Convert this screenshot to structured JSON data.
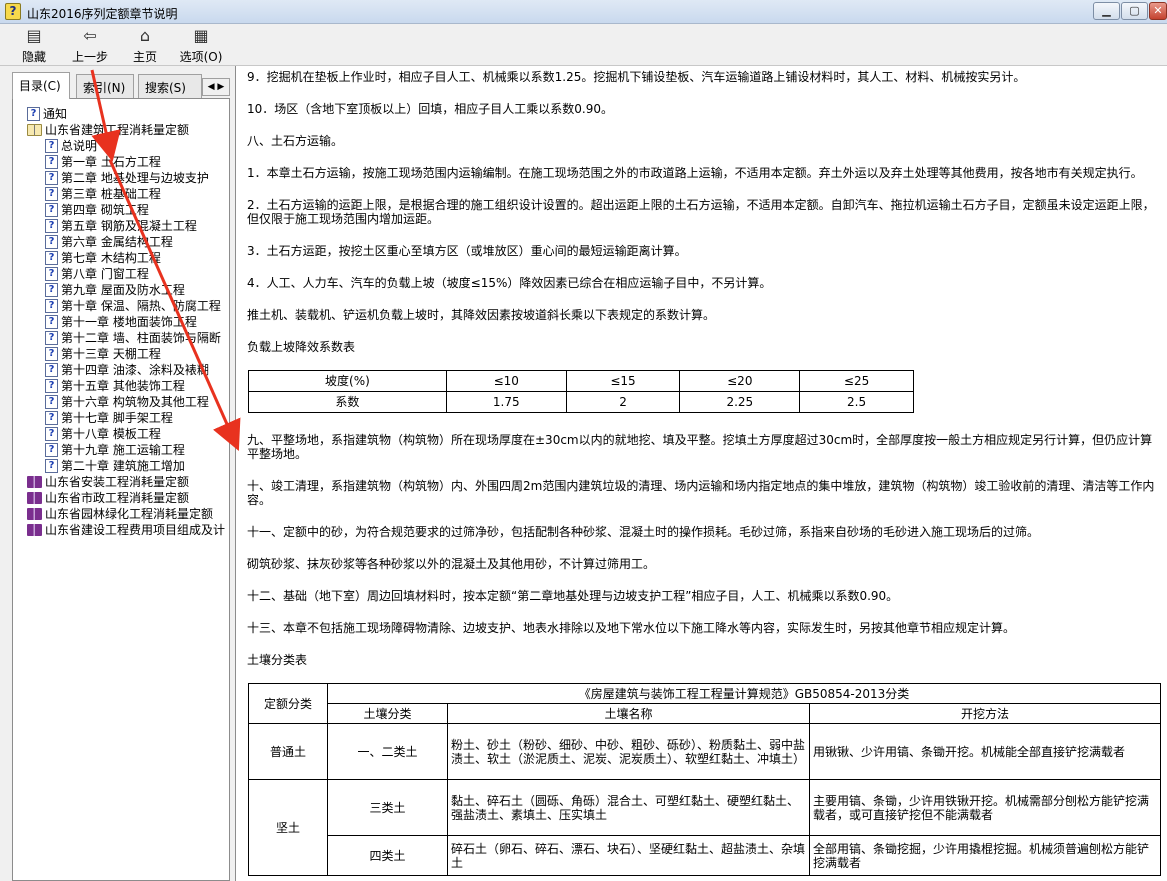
{
  "window": {
    "title": "山东2016序列定额章节说明"
  },
  "toolbar": {
    "hide": "隐藏",
    "back": "上一步",
    "home": "主页",
    "options": "选项(O)"
  },
  "tabs": {
    "contents": "目录(C)",
    "index": "索引(N)",
    "search": "搜索(S)",
    "arrows": "◀ ▶"
  },
  "tree": [
    {
      "label": "通知",
      "icon": "help-page-icon",
      "level": 0
    },
    {
      "label": "山东省建筑工程消耗量定额",
      "icon": "open-book-icon",
      "level": 0
    },
    {
      "label": "总说明",
      "icon": "help-page-icon",
      "level": 1
    },
    {
      "label": "第一章 土石方工程",
      "icon": "help-page-icon",
      "level": 1
    },
    {
      "label": "第二章 地基处理与边坡支护",
      "icon": "help-page-icon",
      "level": 1
    },
    {
      "label": "第三章 桩基础工程",
      "icon": "help-page-icon",
      "level": 1
    },
    {
      "label": "第四章 砌筑工程",
      "icon": "help-page-icon",
      "level": 1
    },
    {
      "label": "第五章 钢筋及混凝土工程",
      "icon": "help-page-icon",
      "level": 1
    },
    {
      "label": "第六章 金属结构工程",
      "icon": "help-page-icon",
      "level": 1
    },
    {
      "label": "第七章 木结构工程",
      "icon": "help-page-icon",
      "level": 1
    },
    {
      "label": "第八章 门窗工程",
      "icon": "help-page-icon",
      "level": 1
    },
    {
      "label": "第九章 屋面及防水工程",
      "icon": "help-page-icon",
      "level": 1
    },
    {
      "label": "第十章 保温、隔热、防腐工程",
      "icon": "help-page-icon",
      "level": 1
    },
    {
      "label": "第十一章 楼地面装饰工程",
      "icon": "help-page-icon",
      "level": 1
    },
    {
      "label": "第十二章 墙、柱面装饰与隔断",
      "icon": "help-page-icon",
      "level": 1
    },
    {
      "label": "第十三章 天棚工程",
      "icon": "help-page-icon",
      "level": 1
    },
    {
      "label": "第十四章 油漆、涂料及裱糊",
      "icon": "help-page-icon",
      "level": 1
    },
    {
      "label": "第十五章 其他装饰工程",
      "icon": "help-page-icon",
      "level": 1
    },
    {
      "label": "第十六章 构筑物及其他工程",
      "icon": "help-page-icon",
      "level": 1
    },
    {
      "label": "第十七章 脚手架工程",
      "icon": "help-page-icon",
      "level": 1
    },
    {
      "label": "第十八章 模板工程",
      "icon": "help-page-icon",
      "level": 1
    },
    {
      "label": "第十九章 施工运输工程",
      "icon": "help-page-icon",
      "level": 1
    },
    {
      "label": "第二十章 建筑施工增加",
      "icon": "help-page-icon",
      "level": 1
    },
    {
      "label": "山东省安装工程消耗量定额",
      "icon": "closed-book-icon",
      "level": 0
    },
    {
      "label": "山东省市政工程消耗量定额",
      "icon": "closed-book-icon",
      "level": 0
    },
    {
      "label": "山东省园林绿化工程消耗量定额",
      "icon": "closed-book-icon",
      "level": 0
    },
    {
      "label": "山东省建设工程费用项目组成及计",
      "icon": "closed-book-icon",
      "level": 0
    }
  ],
  "content": {
    "p1": "9．挖掘机在垫板上作业时，相应子目人工、机械乘以系数1.25。挖掘机下铺设垫板、汽车运输道路上铺设材料时，其人工、材料、机械按实另计。",
    "p2": "10．场区（含地下室顶板以上）回填，相应子目人工乘以系数0.90。",
    "p3": "八、土石方运输。",
    "p4": "1．本章土石方运输，按施工现场范围内运输编制。在施工现场范围之外的市政道路上运输，不适用本定额。弃土外运以及弃土处理等其他费用，按各地市有关规定执行。",
    "p5": "2．土石方运输的运距上限，是根据合理的施工组织设计设置的。超出运距上限的土石方运输，不适用本定额。自卸汽车、拖拉机运输土石方子目，定额虽未设定运距上限，但仅限于施工现场范围内增加运距。",
    "p6": "3．土石方运距，按挖土区重心至填方区（或堆放区）重心间的最短运输距离计算。",
    "p7": "4．人工、人力车、汽车的负载上坡（坡度≤15%）降效因素已综合在相应运输子目中，不另计算。",
    "p8": "推土机、装载机、铲运机负载上坡时，其降效因素按坡道斜长乘以下表规定的系数计算。",
    "p9": "负载上坡降效系数表",
    "grade_table": {
      "row1": [
        "坡度(%)",
        "≤10",
        "≤15",
        "≤20",
        "≤25"
      ],
      "row2": [
        "系数",
        "1.75",
        "2",
        "2.25",
        "2.5"
      ]
    },
    "p10": "九、平整场地，系指建筑物（构筑物）所在现场厚度在±30cm以内的就地挖、填及平整。挖填土方厚度超过30cm时，全部厚度按一般土方相应规定另行计算，但仍应计算平整场地。",
    "p11": "十、竣工清理，系指建筑物（构筑物）内、外围四周2m范围内建筑垃圾的清理、场内运输和场内指定地点的集中堆放，建筑物（构筑物）竣工验收前的清理、清洁等工作内容。",
    "p12": "十一、定额中的砂，为符合规范要求的过筛净砂，包括配制各种砂浆、混凝土时的操作损耗。毛砂过筛，系指来自砂场的毛砂进入施工现场后的过筛。",
    "p13": "砌筑砂浆、抹灰砂浆等各种砂浆以外的混凝土及其他用砂，不计算过筛用工。",
    "p14": "十二、基础（地下室）周边回填材料时，按本定额“第二章地基处理与边坡支护工程”相应子目，人工、机械乘以系数0.90。",
    "p15": "十三、本章不包括施工现场障碍物清除、边坡支护、地表水排除以及地下常水位以下施工降水等内容，实际发生时，另按其他章节相应规定计算。",
    "p16": "土壤分类表",
    "soil_table": {
      "h_class": "定额分类",
      "h_spec": "《房屋建筑与装饰工程工程量计算规范》GB50854-2013分类",
      "h_soil": "土壤分类",
      "h_name": "土壤名称",
      "h_method": "开挖方法",
      "r1_class": "普通土",
      "r1_soil": "一、二类土",
      "r1_name": "粉土、砂土（粉砂、细砂、中砂、粗砂、砾砂）、粉质黏土、弱中盐渍土、软土（淤泥质土、泥炭、泥炭质土）、软塑红黏土、冲填土）",
      "r1_method": "用锹锹、少许用镐、条锄开挖。机械能全部直接铲挖满载者",
      "r2_class": "坚土",
      "r2_soil": "三类土",
      "r2_name": "黏土、碎石土（圆砾、角砾）混合土、可塑红黏土、硬塑红黏土、强盐渍土、素填土、压实填土",
      "r2_method": "主要用镐、条锄，少许用铁锹开挖。机械需部分刨松方能铲挖满载者，或可直接铲挖但不能满载者",
      "r3_soil": "四类土",
      "r3_name": "碎石土（卵石、碎石、漂石、块石）、坚硬红黏土、超盐渍土、杂填土",
      "r3_method": "全部用镐、条锄挖掘，少许用撬棍挖掘。机械须普遍刨松方能铲挖满载者"
    }
  }
}
